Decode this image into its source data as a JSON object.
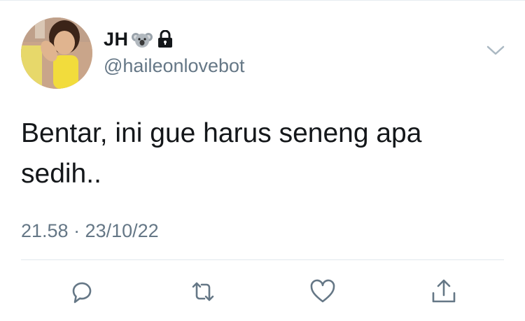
{
  "user": {
    "display_name": "JH",
    "handle": "@haileonlovebot",
    "badges": [
      "koala-emoji-icon",
      "lock-icon"
    ]
  },
  "tweet": {
    "text": "Bentar, ini gue harus seneng apa sedih..",
    "timestamp": "21.58 · 23/10/22"
  },
  "actions": [
    "reply-icon",
    "retweet-icon",
    "like-icon",
    "share-icon"
  ],
  "colors": {
    "text_primary": "#14171a",
    "text_secondary": "#657786",
    "icon": "#657786",
    "divider": "#e1e8ed"
  }
}
